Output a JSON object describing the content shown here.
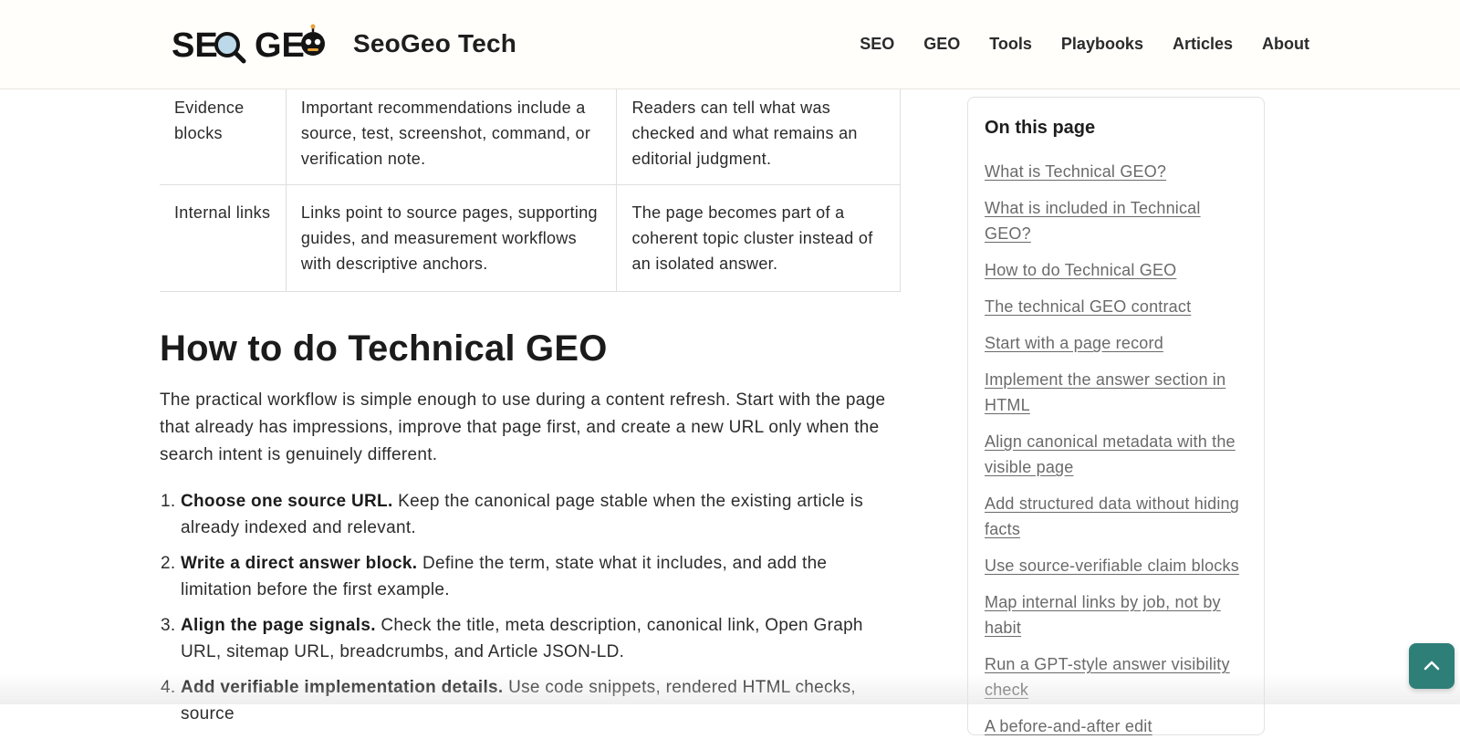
{
  "header": {
    "logo_text": "SEO GEO",
    "brand_name": "SeoGeo Tech",
    "nav": [
      "SEO",
      "GEO",
      "Tools",
      "Playbooks",
      "Articles",
      "About"
    ]
  },
  "table": {
    "rows": [
      {
        "col1": "Evidence blocks",
        "col2": "Important recommendations include a source, test, screenshot, command, or verification note.",
        "col3": "Readers can tell what was checked and what remains an editorial judgment."
      },
      {
        "col1": "Internal links",
        "col2": "Links point to source pages, supporting guides, and measurement workflows with descriptive anchors.",
        "col3": "The page becomes part of a coherent topic cluster instead of an isolated answer."
      }
    ]
  },
  "section": {
    "heading": "How to do Technical GEO",
    "intro": "The practical workflow is simple enough to use during a content refresh. Start with the page that already has impressions, improve that page first, and create a new URL only when the search intent is genuinely different.",
    "steps": [
      {
        "title": "Choose one source URL.",
        "text": " Keep the canonical page stable when the existing article is already indexed and relevant."
      },
      {
        "title": "Write a direct answer block.",
        "text": " Define the term, state what it includes, and add the limitation before the first example."
      },
      {
        "title": "Align the page signals.",
        "text": " Check the title, meta description, canonical link, Open Graph URL, sitemap URL, breadcrumbs, and Article JSON-LD."
      },
      {
        "title": "Add verifiable implementation details.",
        "text": " Use code snippets, rendered HTML checks, source"
      }
    ]
  },
  "toc": {
    "title": "On this page",
    "items": [
      "What is Technical GEO?",
      "What is included in Technical GEO?",
      "How to do Technical GEO",
      "The technical GEO contract",
      "Start with a page record",
      "Implement the answer section in HTML",
      "Align canonical metadata with the visible page",
      "Add structured data without hiding facts",
      "Use source-verifiable claim blocks",
      "Map internal links by job, not by habit",
      "Run a GPT-style answer visibility check",
      "A before-and-after edit"
    ]
  },
  "colors": {
    "accent": "#2f7f79",
    "link": "#6a6a6a",
    "header_bg": "#fffefb"
  },
  "icons": {
    "back_to_top": "chevron-up-icon",
    "logo_magnifier": "magnifier-icon",
    "logo_robot": "robot-icon"
  }
}
